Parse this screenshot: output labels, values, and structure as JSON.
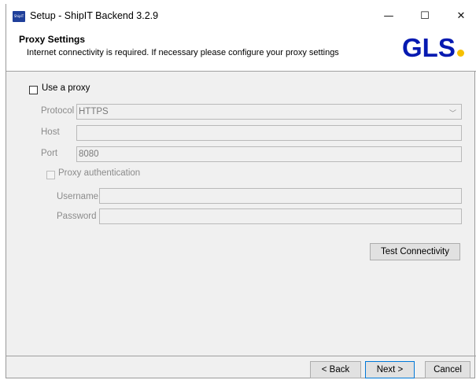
{
  "window": {
    "title": "Setup - ShipIT Backend 3.2.9",
    "app_icon_text": "ShipIT",
    "controls": {
      "minimize": "—",
      "maximize": "☐",
      "close": "✕"
    }
  },
  "header": {
    "title": "Proxy Settings",
    "subtitle": "Internet connectivity is required. If necessary please configure your proxy settings",
    "logo_text": "GLS",
    "logo_color": "#061ab1",
    "logo_dot_color": "#f6c000"
  },
  "form": {
    "use_proxy_label": "Use a proxy",
    "use_proxy_checked": false,
    "protocol_label": "Protocol",
    "protocol_value": "HTTPS",
    "host_label": "Host",
    "host_value": "",
    "port_label": "Port",
    "port_value": "8080",
    "proxy_auth_label": "Proxy authentication",
    "proxy_auth_checked": false,
    "username_label": "Username",
    "username_value": "",
    "password_label": "Password",
    "password_value": "",
    "test_button": "Test Connectivity"
  },
  "footer": {
    "back": "< Back",
    "next": "Next >",
    "cancel": "Cancel"
  }
}
